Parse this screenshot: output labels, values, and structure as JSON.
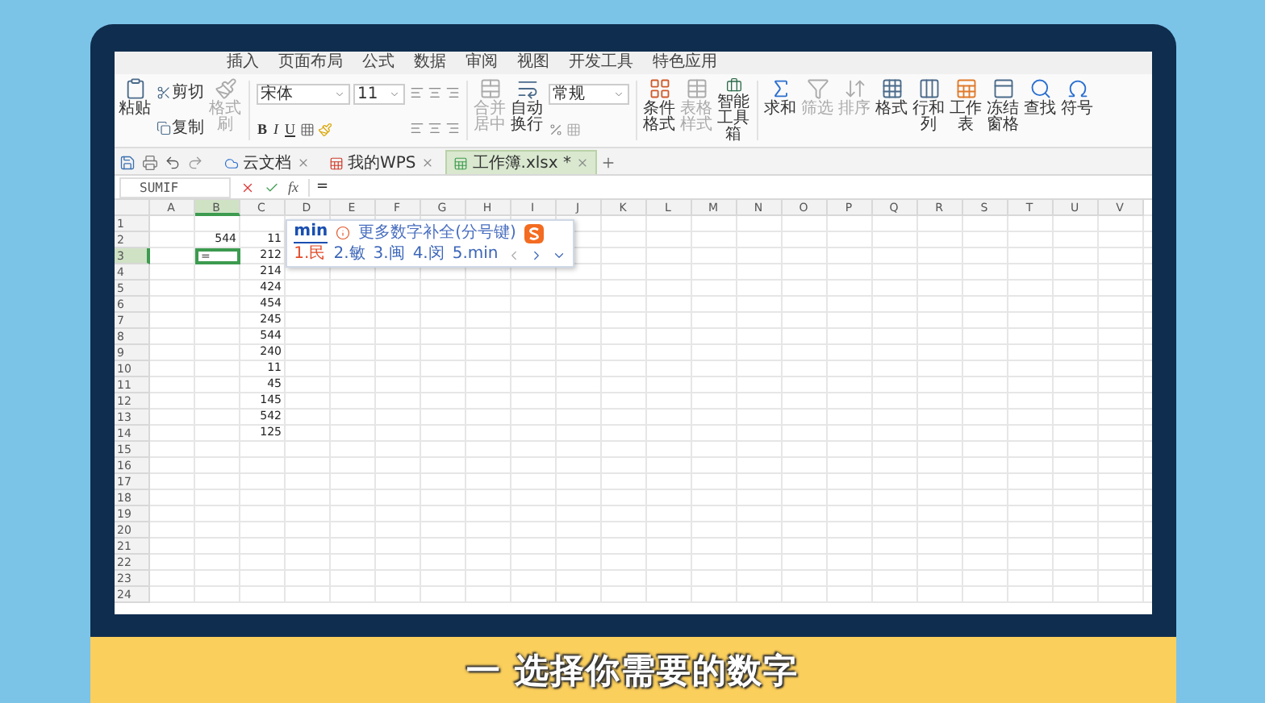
{
  "menu_tabs": [
    {
      "label": "插入",
      "selected": false
    },
    {
      "label": "页面布局",
      "selected": false
    },
    {
      "label": "公式",
      "selected": false
    },
    {
      "label": "数据",
      "selected": false
    },
    {
      "label": "审阅",
      "selected": false
    },
    {
      "label": "视图",
      "selected": false
    },
    {
      "label": "开发工具",
      "selected": false
    },
    {
      "label": "特色应用",
      "selected": false
    }
  ],
  "ribbon": {
    "items": [
      {
        "kind": "large",
        "label": "粘贴",
        "disabled": false
      },
      {
        "kind": "pair",
        "top": "剪切",
        "bottom": "复制",
        "disabled": false
      },
      {
        "kind": "large",
        "label": "格式刷",
        "disabled": true
      },
      {
        "kind": "font",
        "font": "宋体",
        "size": "11",
        "buttons": [
          "B",
          "I",
          "U"
        ]
      },
      {
        "kind": "align"
      },
      {
        "kind": "large",
        "label": "合并居中",
        "disabled": true
      },
      {
        "kind": "large",
        "label": "自动换行",
        "disabled": false
      },
      {
        "kind": "number",
        "format": "常规"
      },
      {
        "kind": "large",
        "label": "条件格式",
        "disabled": false
      },
      {
        "kind": "large",
        "label": "表格样式",
        "disabled": true
      },
      {
        "kind": "large",
        "label": "智能工具箱",
        "disabled": false
      },
      {
        "kind": "large",
        "label": "求和",
        "disabled": false
      },
      {
        "kind": "large",
        "label": "筛选",
        "disabled": true
      },
      {
        "kind": "large",
        "label": "排序",
        "disabled": true
      },
      {
        "kind": "large",
        "label": "格式",
        "disabled": false
      },
      {
        "kind": "large",
        "label": "行和列",
        "disabled": false
      },
      {
        "kind": "large",
        "label": "工作表",
        "disabled": false
      },
      {
        "kind": "large",
        "label": "冻结窗格",
        "disabled": false
      },
      {
        "kind": "large",
        "label": "查找",
        "disabled": false
      },
      {
        "kind": "large",
        "label": "符号",
        "disabled": false
      }
    ]
  },
  "doc_tabs": [
    {
      "label": "云文档",
      "selected": false
    },
    {
      "label": "我的WPS",
      "selected": false
    },
    {
      "label": "工作簿.xlsx *",
      "selected": true
    }
  ],
  "formula_bar": {
    "name_box": "SUMIF",
    "function_label": "fx",
    "value": "="
  },
  "ime": {
    "typed": "min",
    "hint": "更多数字补全(分号键)",
    "candidates": [
      "1.民",
      "2.敏",
      "3.闽",
      "4.闵",
      "5.min"
    ]
  },
  "columns": [
    {
      "label": "A",
      "selected": false
    },
    {
      "label": "B",
      "selected": true
    },
    {
      "label": "C",
      "selected": false
    },
    {
      "label": "D",
      "selected": false
    },
    {
      "label": "E",
      "selected": false
    },
    {
      "label": "F",
      "selected": false
    },
    {
      "label": "G",
      "selected": false
    },
    {
      "label": "H",
      "selected": false
    },
    {
      "label": "I",
      "selected": false
    },
    {
      "label": "J",
      "selected": false
    },
    {
      "label": "K",
      "selected": false
    },
    {
      "label": "L",
      "selected": false
    },
    {
      "label": "M",
      "selected": false
    },
    {
      "label": "N",
      "selected": false
    },
    {
      "label": "O",
      "selected": false
    },
    {
      "label": "P",
      "selected": false
    },
    {
      "label": "Q",
      "selected": false
    },
    {
      "label": "R",
      "selected": false
    },
    {
      "label": "S",
      "selected": false
    },
    {
      "label": "T",
      "selected": false
    },
    {
      "label": "U",
      "selected": false
    },
    {
      "label": "V",
      "selected": false
    }
  ],
  "rows": [
    {
      "number": "1",
      "selected": false
    },
    {
      "number": "2",
      "selected": false,
      "column_b": {
        "value": "544",
        "active": false
      },
      "column_c": {
        "value": "11",
        "active": false
      }
    },
    {
      "number": "3",
      "selected": true,
      "column_b": {
        "value": "=",
        "active": true
      },
      "column_c": {
        "value": "212",
        "active": false
      }
    },
    {
      "number": "4",
      "selected": false,
      "column_c": {
        "value": "214",
        "active": false
      }
    },
    {
      "number": "5",
      "selected": false,
      "column_c": {
        "value": "424",
        "active": false
      }
    },
    {
      "number": "6",
      "selected": false,
      "column_c": {
        "value": "454",
        "active": false
      }
    },
    {
      "number": "7",
      "selected": false,
      "column_c": {
        "value": "245",
        "active": false
      }
    },
    {
      "number": "8",
      "selected": false,
      "column_c": {
        "value": "544",
        "active": false
      }
    },
    {
      "number": "9",
      "selected": false,
      "column_c": {
        "value": "240",
        "active": false
      }
    },
    {
      "number": "10",
      "selected": false,
      "column_c": {
        "value": "11",
        "active": false
      }
    },
    {
      "number": "11",
      "selected": false,
      "column_c": {
        "value": "45",
        "active": false
      }
    },
    {
      "number": "12",
      "selected": false,
      "column_c": {
        "value": "145",
        "active": false
      }
    },
    {
      "number": "13",
      "selected": false,
      "column_c": {
        "value": "542",
        "active": false
      }
    },
    {
      "number": "14",
      "selected": false,
      "column_c": {
        "value": "125",
        "active": false
      }
    },
    {
      "number": "15",
      "selected": false
    },
    {
      "number": "16",
      "selected": false
    },
    {
      "number": "17",
      "selected": false
    },
    {
      "number": "18",
      "selected": false
    },
    {
      "number": "19",
      "selected": false
    },
    {
      "number": "20",
      "selected": false
    },
    {
      "number": "21",
      "selected": false
    },
    {
      "number": "22",
      "selected": false
    },
    {
      "number": "23",
      "selected": false
    },
    {
      "number": "24",
      "selected": false
    }
  ],
  "caption": "一 选择你需要的数字"
}
